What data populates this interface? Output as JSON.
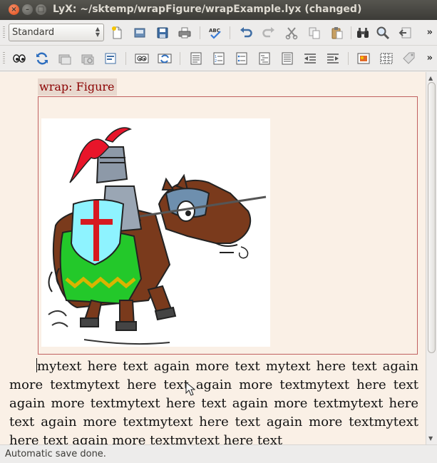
{
  "window": {
    "title": "LyX: ~/sktemp/wrapFigure/wrapExample.lyx (changed)",
    "close_glyph": "×",
    "min_glyph": "–",
    "max_glyph": "□"
  },
  "toolbar1": {
    "layout_value": "Standard",
    "overflow": "»",
    "icons": [
      "new-document-icon",
      "open-icon",
      "save-icon",
      "print-icon",
      "spellcheck-icon",
      "undo-icon",
      "redo-icon",
      "cut-icon",
      "copy-icon",
      "paste-icon",
      "find-icon",
      "zoom-icon",
      "back-icon"
    ]
  },
  "toolbar2": {
    "overflow": "»",
    "icons": [
      "view-icon",
      "update-icon",
      "view-master-icon",
      "update-master-icon",
      "export-icon",
      "view-other-icon",
      "update-other-icon",
      "list-icon",
      "enum-list-icon",
      "itemize-icon",
      "description-icon",
      "description2-icon",
      "indent-left-icon",
      "indent-right-icon",
      "insert-graphics-icon",
      "insert-table-icon",
      "insert-label-icon"
    ]
  },
  "document": {
    "inset_label": "wrap: Figure",
    "figure_icon": "knight-on-horse-image",
    "paragraph": "mytext here text again more text mytext here text again more textmytext here text again more textmytext here text again more textmytext here text again more textmytext here text again more textmytext here text again more textmytext here text again more textmytext here text"
  },
  "status": {
    "message": "Automatic save done."
  }
}
